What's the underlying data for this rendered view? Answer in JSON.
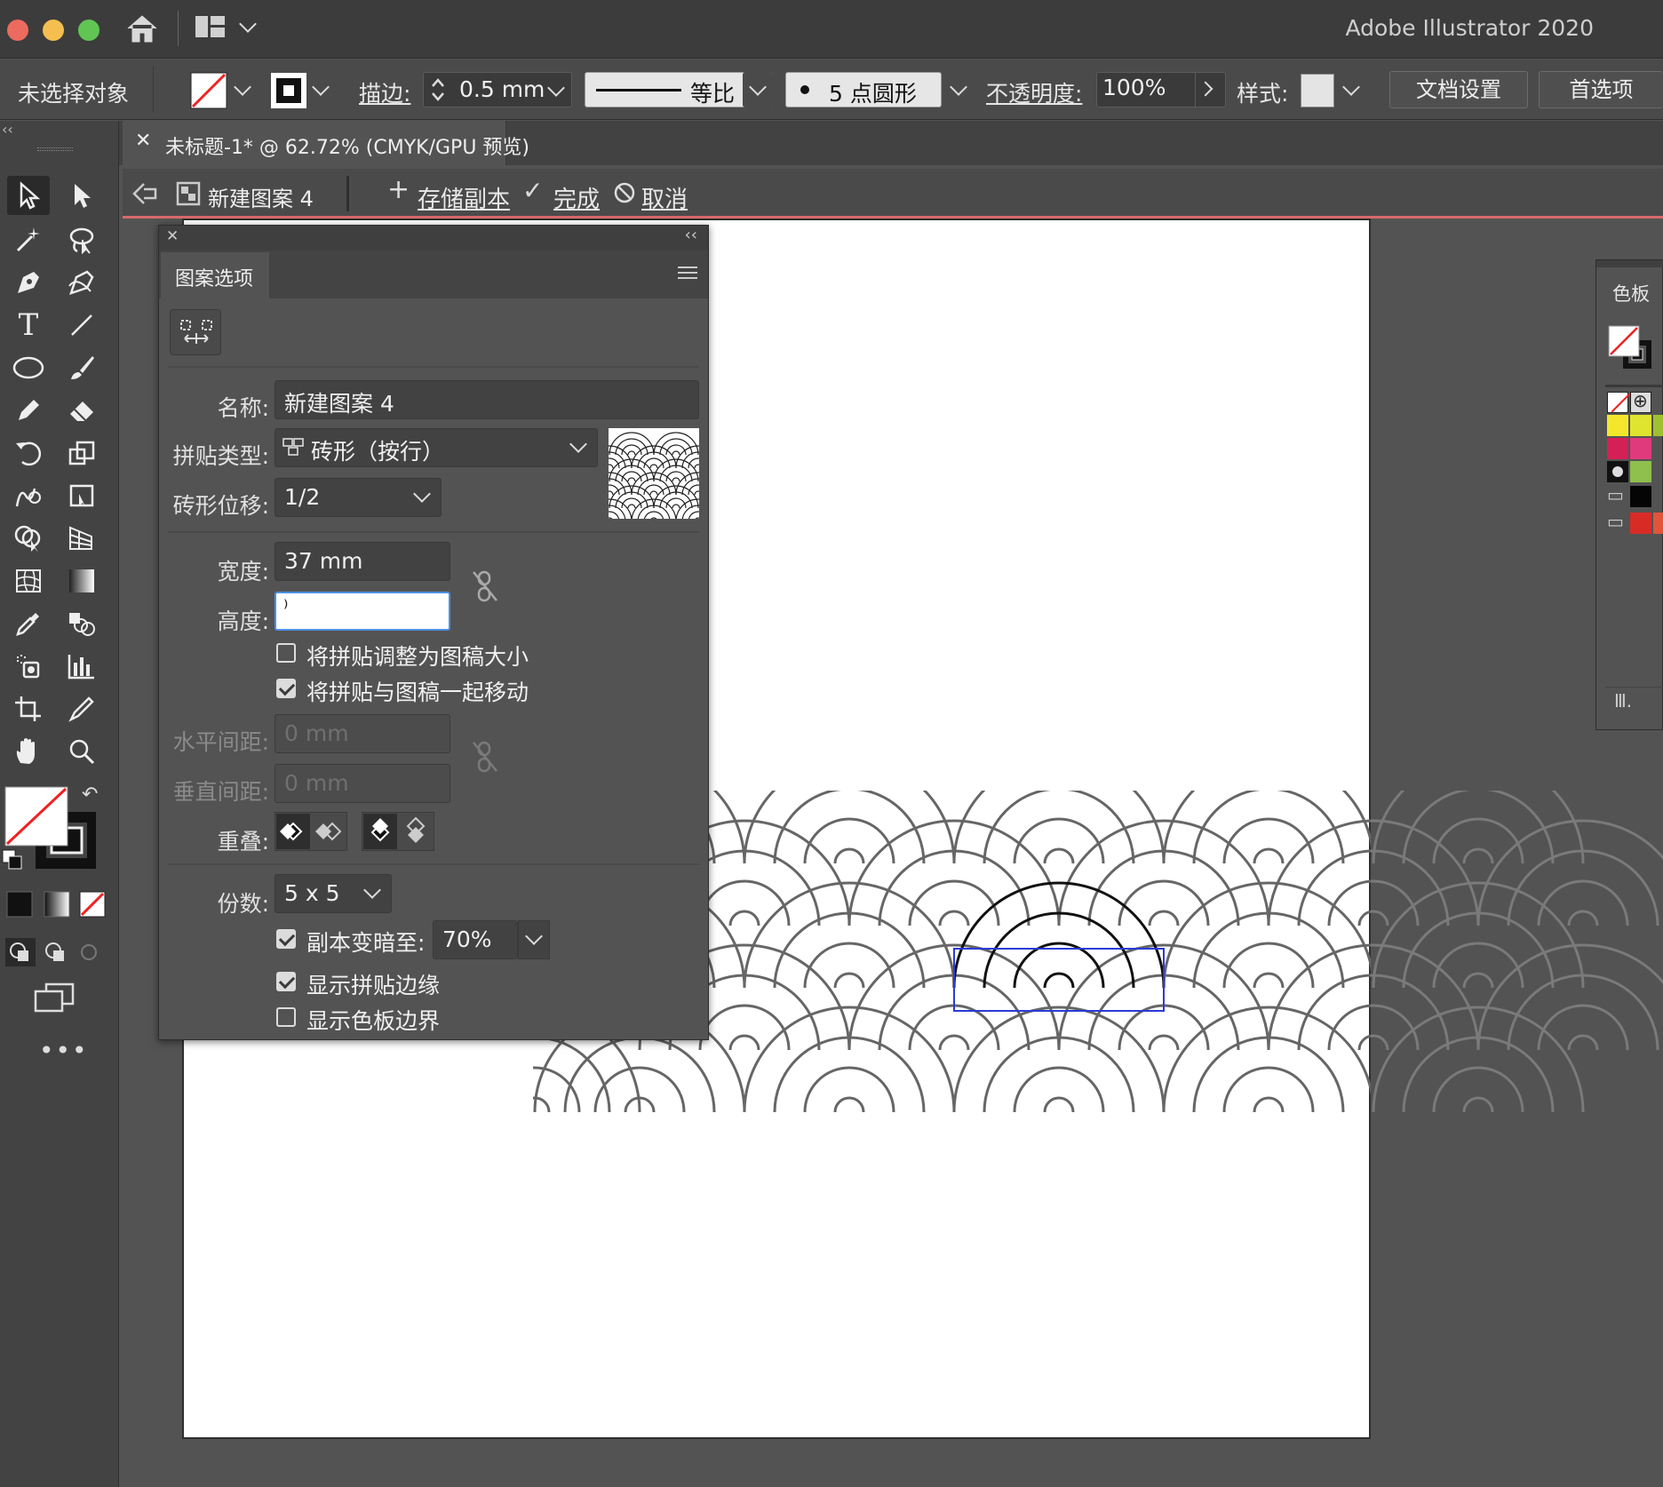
{
  "app": {
    "title": "Adobe Illustrator 2020"
  },
  "control_bar": {
    "selection_label": "未选择对象",
    "stroke_label": "描边:",
    "stroke_value": "0.5 mm",
    "profile_label": "等比",
    "brush_label": "5 点圆形",
    "opacity_label": "不透明度:",
    "opacity_value": "100%",
    "style_label": "样式:",
    "doc_setup_label": "文档设置",
    "preferences_label": "首选项"
  },
  "document_tab": {
    "title": "未标题-1* @ 62.72% (CMYK/GPU 预览)"
  },
  "pattern_bar": {
    "pattern_name": "新建图案 4",
    "save_copy_label": "存储副本",
    "done_label": "完成",
    "cancel_label": "取消"
  },
  "pattern_panel": {
    "tab_label": "图案选项",
    "name_label": "名称:",
    "name_value": "新建图案 4",
    "tile_type_label": "拼贴类型:",
    "tile_type_value": "砖形（按行）",
    "brick_offset_label": "砖形位移:",
    "brick_offset_value": "1/2",
    "width_label": "宽度:",
    "width_value": "37 mm",
    "height_label": "高度:",
    "height_value": "⁾",
    "size_to_art_label": "将拼贴调整为图稿大小",
    "size_to_art_checked": false,
    "move_tile_label": "将拼贴与图稿一起移动",
    "move_tile_checked": true,
    "h_spacing_label": "水平间距:",
    "h_spacing_value": "0 mm",
    "v_spacing_label": "垂直间距:",
    "v_spacing_value": "0 mm",
    "overlap_label": "重叠:",
    "copies_label": "份数:",
    "copies_value": "5 x 5",
    "dim_copies_label": "副本变暗至:",
    "dim_copies_checked": true,
    "dim_copies_value": "70%",
    "show_tile_edge_label": "显示拼贴边缘",
    "show_tile_edge_checked": true,
    "show_swatch_bounds_label": "显示色板边界",
    "show_swatch_bounds_checked": false
  },
  "swatches_panel": {
    "title": "色板"
  },
  "colors": {
    "ui_dark": "#434343",
    "artboard": "#ffffff",
    "selection_blue": "#2a3bd6",
    "pattern_edit_accent": "#d86a6a"
  }
}
